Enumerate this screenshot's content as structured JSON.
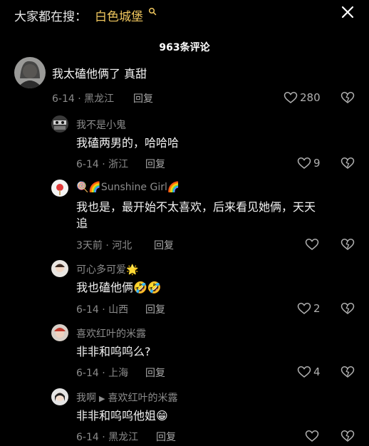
{
  "topbar": {
    "search_prefix": "大家都在搜：",
    "search_term": "白色城堡"
  },
  "comment_count": "963条评论",
  "comments": [
    {
      "text": "我太磕他俩了 真甜",
      "date_location": "6-14 · 黑龙江",
      "reply": "回复",
      "likes": "280"
    },
    {
      "username": "我不是小鬼",
      "text": "我磕两男的，哈哈哈",
      "date_location": "6-14 · 浙江",
      "reply": "回复",
      "likes": "9"
    },
    {
      "username": "🍭🌈Sunshine Girl🌈",
      "text_line1": "我也是，最开始不太喜欢，后来看见她俩，天天",
      "text_line2": "追",
      "date_location": "3天前 · 河北",
      "reply": "回复"
    },
    {
      "username": "可心多可爱🌟",
      "text": "我也磕他俩🤣🤣",
      "date_location": "6-14 · 山西",
      "reply": "回复",
      "likes": "2"
    },
    {
      "username": "喜欢红叶的米露",
      "text": "非非和呜呜么?",
      "date_location": "6-14 · 上海",
      "reply": "回复",
      "likes": "4"
    },
    {
      "username": "我啊",
      "reply_to": "喜欢红叶的米露",
      "text": "非非和呜呜他姐😁",
      "date_location": "6-14 · 黑龙江",
      "reply": "回复"
    }
  ]
}
